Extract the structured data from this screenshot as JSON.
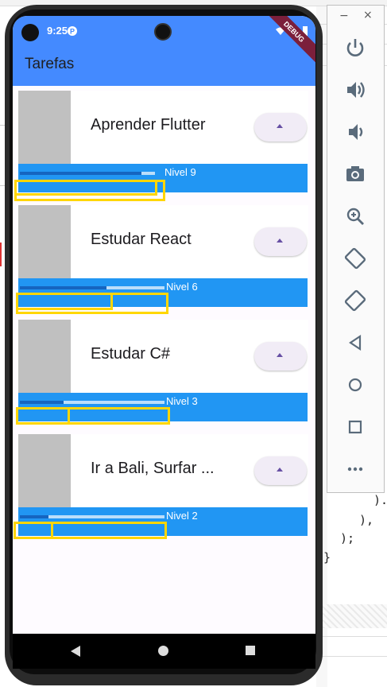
{
  "phone": {
    "status_time": "9:25",
    "debug_banner": "DEBUG",
    "app_title": "Tarefas",
    "colors": {
      "appbar": "#448aff",
      "level_bar": "#2196f3",
      "highlight": "#ffd600"
    }
  },
  "tasks": [
    {
      "name": "Aprender Flutter",
      "level_label": "Nivel 9",
      "progress": 0.9
    },
    {
      "name": "Estudar React",
      "level_label": "Nivel 6",
      "progress": 0.6
    },
    {
      "name": "Estudar C#",
      "level_label": "Nivel 3",
      "progress": 0.3
    },
    {
      "name": "Ir a Bali, Surfar ...",
      "level_label": "Nivel 2",
      "progress": 0.2
    }
  ],
  "nav": {
    "icons": [
      "back-icon",
      "home-icon",
      "recents-icon"
    ]
  },
  "emulator_panel": {
    "minimize": "−",
    "close": "×",
    "tools": [
      "power-icon",
      "volume-up-icon",
      "volume-down-icon",
      "camera-icon",
      "zoom-icon",
      "rotate-left-icon",
      "rotate-right-icon",
      "back-icon",
      "home-icon",
      "overview-icon",
      "more-icon"
    ]
  },
  "ide_code": [
    ").",
    "),",
    ");",
    "}"
  ]
}
